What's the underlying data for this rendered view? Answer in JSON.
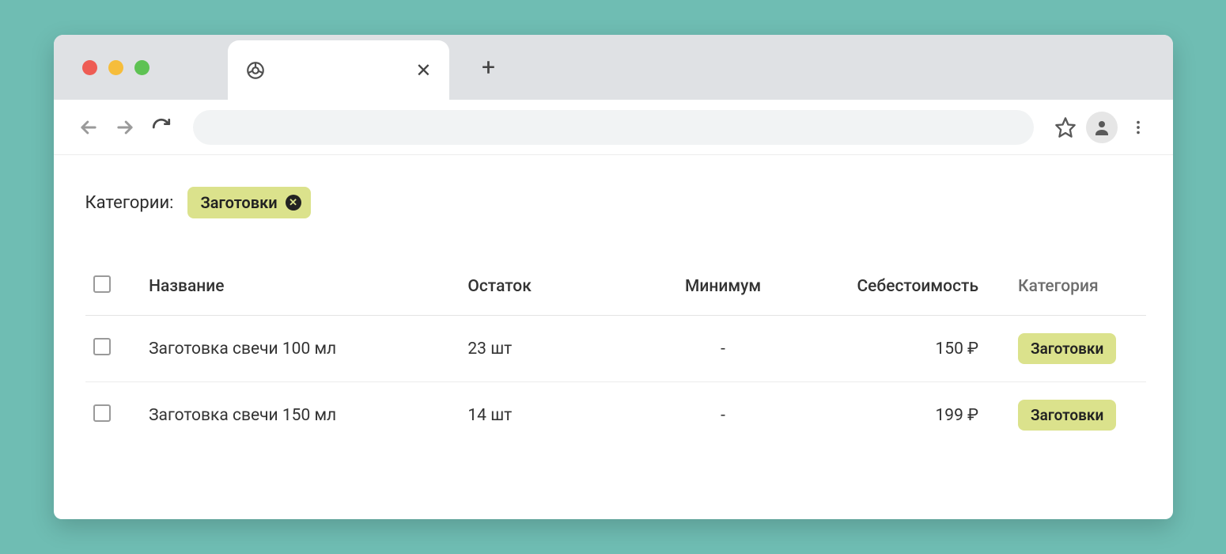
{
  "filter": {
    "label": "Категории:",
    "chip": "Заготовки"
  },
  "table": {
    "headers": {
      "name": "Название",
      "stock": "Остаток",
      "min": "Минимум",
      "cost": "Себестоимость",
      "category": "Категория"
    },
    "rows": [
      {
        "name": "Заготовка свечи 100 мл",
        "stock": "23 шт",
        "min": "-",
        "cost": "150 ₽",
        "category": "Заготовки"
      },
      {
        "name": "Заготовка свечи 150 мл",
        "stock": "14 шт",
        "min": "-",
        "cost": "199 ₽",
        "category": "Заготовки"
      }
    ]
  }
}
